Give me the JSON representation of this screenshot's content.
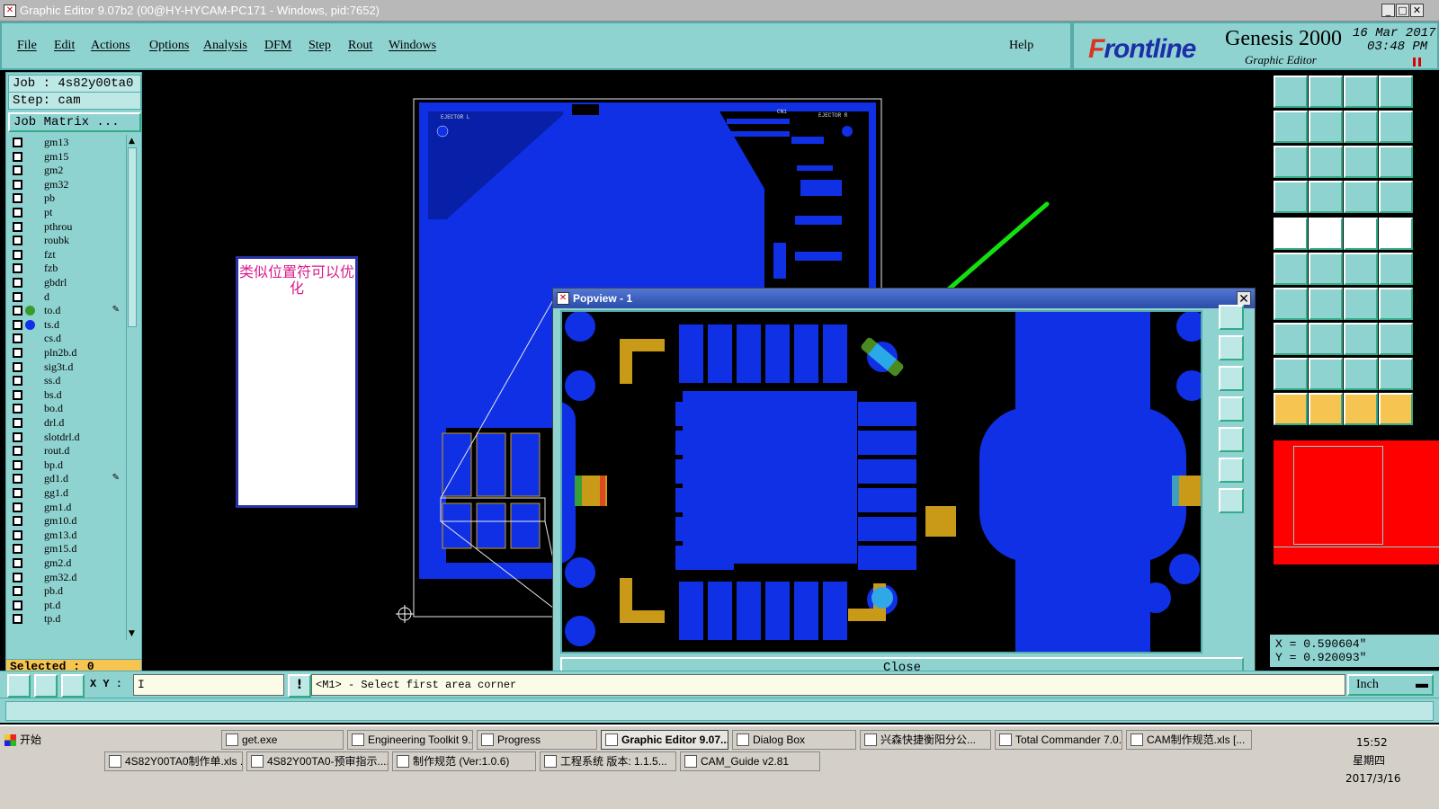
{
  "window": {
    "title": "Graphic Editor 9.07b2 (00@HY-HYCAM-PC171 - Windows, pid:7652)"
  },
  "menu": [
    "File",
    "Edit",
    "Actions",
    "Options",
    "Analysis",
    "DFM",
    "Step",
    "Rout",
    "Windows"
  ],
  "help": "Help",
  "brand": {
    "logo_f": "F",
    "logo_rest": "rontline",
    "product": "Genesis 2000",
    "subtitle": "Graphic Editor",
    "date": "16 Mar 2017",
    "time": "03:48 PM"
  },
  "job": {
    "job_line": "Job : 4s82y00ta0",
    "step_line": "Step: cam",
    "matrix_btn": "Job Matrix ..."
  },
  "layers": [
    {
      "name": "gm13",
      "dot": ""
    },
    {
      "name": "gm15",
      "dot": ""
    },
    {
      "name": "gm2",
      "dot": ""
    },
    {
      "name": "gm32",
      "dot": ""
    },
    {
      "name": "pb",
      "dot": ""
    },
    {
      "name": "pt",
      "dot": ""
    },
    {
      "name": "pthrou",
      "dot": ""
    },
    {
      "name": "roubk",
      "dot": ""
    },
    {
      "name": "fzt",
      "dot": ""
    },
    {
      "name": "fzb",
      "dot": ""
    },
    {
      "name": "gbdrl",
      "dot": ""
    },
    {
      "name": "d",
      "dot": ""
    },
    {
      "name": "to.d",
      "dot": "#3a9b2a",
      "mark": "✎"
    },
    {
      "name": "ts.d",
      "dot": "#1430e8"
    },
    {
      "name": "cs.d",
      "dot": ""
    },
    {
      "name": "pln2b.d",
      "dot": ""
    },
    {
      "name": "sig3t.d",
      "dot": ""
    },
    {
      "name": "ss.d",
      "dot": ""
    },
    {
      "name": "bs.d",
      "dot": ""
    },
    {
      "name": "bo.d",
      "dot": ""
    },
    {
      "name": "drl.d",
      "dot": ""
    },
    {
      "name": "slotdrl.d",
      "dot": ""
    },
    {
      "name": "rout.d",
      "dot": ""
    },
    {
      "name": "bp.d",
      "dot": ""
    },
    {
      "name": "gd1.d",
      "dot": "",
      "mark": "✎"
    },
    {
      "name": "gg1.d",
      "dot": ""
    },
    {
      "name": "gm1.d",
      "dot": ""
    },
    {
      "name": "gm10.d",
      "dot": ""
    },
    {
      "name": "gm13.d",
      "dot": ""
    },
    {
      "name": "gm15.d",
      "dot": ""
    },
    {
      "name": "gm2.d",
      "dot": ""
    },
    {
      "name": "gm32.d",
      "dot": ""
    },
    {
      "name": "pb.d",
      "dot": ""
    },
    {
      "name": "pt.d",
      "dot": ""
    },
    {
      "name": "tp.d",
      "dot": ""
    }
  ],
  "selected": "Selected : 0",
  "note": {
    "text": "类似位置符可以优化"
  },
  "board": {
    "label_left": "EJECTOR L",
    "label_right": "EJECTOR R",
    "label_cn": "CN1"
  },
  "popview": {
    "title": "Popview - 1",
    "close": "Close"
  },
  "coords": {
    "x": "X = 0.590604\"",
    "y": "Y = 0.920093\""
  },
  "cmd": {
    "xy_label": "X Y :",
    "input_value": "I",
    "message": "<M1> - Select first area corner",
    "unit": "Inch"
  },
  "taskbar": {
    "start": "开始",
    "row1": [
      "get.exe",
      "Engineering Toolkit 9....",
      "Progress",
      "Graphic Editor 9.07...",
      "Dialog Box",
      "兴森快捷衡阳分公...",
      "Total Commander 7.0...",
      "CAM制作规范.xls [..."
    ],
    "row2": [
      "4S82Y00TA0制作单.xls ...",
      "4S82Y00TA0-预审指示....",
      "制作规范 (Ver:1.0.6)",
      "工程系统  版本: 1.1.5...",
      "CAM_Guide v2.81"
    ],
    "clock_time": "15:52",
    "clock_day": "星期四",
    "clock_date": "2017/3/16"
  },
  "colors": {
    "panel": "#8fd3d1",
    "copper": "#1030e6",
    "silk": "#c89a18",
    "highlight": "#14e010",
    "minimap": "#ff0000"
  }
}
